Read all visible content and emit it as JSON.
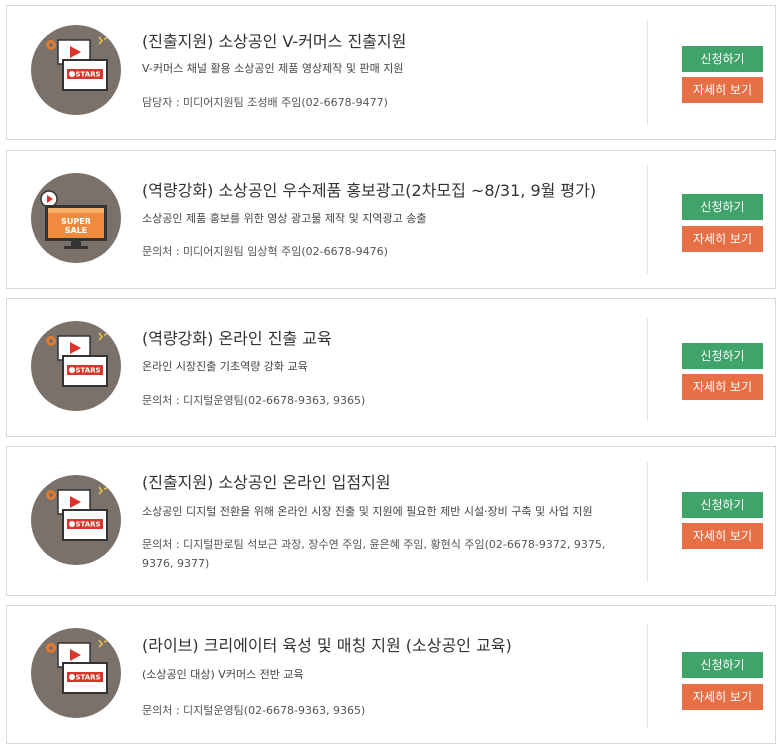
{
  "colors": {
    "apply": "#3fa36a",
    "detail": "#e66f45",
    "thumb_bg": "#7b716b"
  },
  "programs": [
    {
      "title": "(진출지원) 소상공인 V-커머스 진출지원",
      "desc": "V-커머스 채널 활용 소상공인 제품 영상제작 및 판매 지원",
      "contact": "담당자 : 미디어지원팀 조성배 주임(02-6678-9477)",
      "icon": "tv-stars-icon",
      "apply_label": "신청하기",
      "detail_label": "자세히 보기"
    },
    {
      "title": "(역량강화) 소상공인 우수제품 홍보광고(2차모집 ~8/31, 9월 평가)",
      "desc": "소상공인 제품 홍보를 위한 영상 광고물 제작 및 지역광고 송출",
      "contact": "문의처 : 미디어지원팀 임상혁 주임(02-6678-9476)",
      "icon": "tv-super-sale-icon",
      "icon_text": [
        "SUPER",
        "SALE"
      ],
      "apply_label": "신청하기",
      "detail_label": "자세히 보기"
    },
    {
      "title": "(역량강화) 온라인 진출 교육",
      "desc": "온라인 시장진출 기초역량 강화 교육",
      "contact": "문의처 : 디지털운영팀(02-6678-9363, 9365)",
      "icon": "tv-stars-icon",
      "apply_label": "신청하기",
      "detail_label": "자세히 보기"
    },
    {
      "title": "(진출지원) 소상공인 온라인 입점지원",
      "desc": "소상공인 디지털 전환을 위해 온라인 시장 진출 및 지원에 필요한 제반 시설·장비 구축 및 사업 지원",
      "contact": "문의처 : 디지털판로팀 석보근 과장, 장수연 주임, 윤은혜 주임, 황현식 주임(02-6678-9372, 9375, 9376, 9377)",
      "icon": "tv-stars-icon",
      "apply_label": "신청하기",
      "detail_label": "자세히 보기"
    },
    {
      "title": "(라이브) 크리에이터 육성 및 매칭 지원 (소상공인 교육)",
      "desc": "(소상공인 대상) V커머스 전반 교육",
      "contact": "문의처 : 디지털운영팀(02-6678-9363, 9365)",
      "icon": "tv-stars-icon",
      "apply_label": "신청하기",
      "detail_label": "자세히 보기"
    }
  ]
}
